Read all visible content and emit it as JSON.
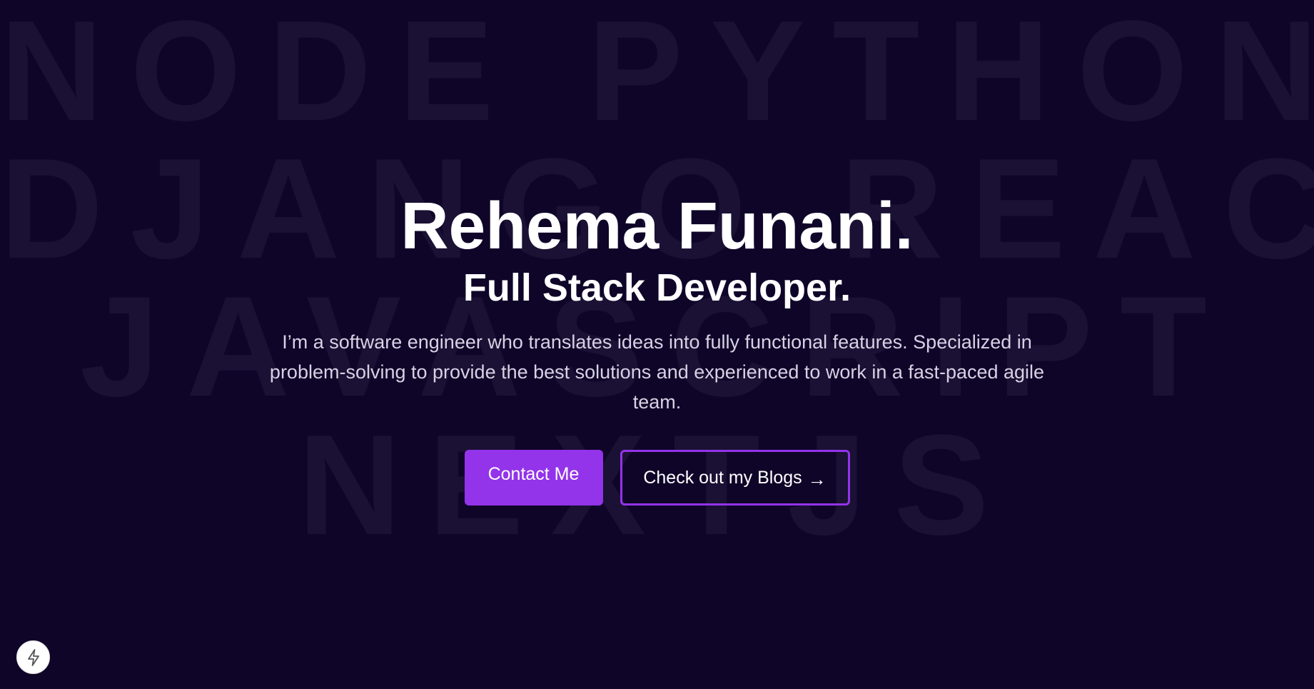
{
  "background_words": [
    "NODE PYTHON",
    "DJANGO REACT",
    "JAVASCRIPT",
    "NEXTJS"
  ],
  "hero": {
    "name": "Rehema Funani.",
    "role": "Full Stack Developer.",
    "bio": "I’m a software engineer who translates ideas into fully functional features. Specialized in problem-solving to provide the best solutions and experienced to work in a fast-paced agile team."
  },
  "actions": {
    "contact_label": "Contact Me",
    "blogs_label": "Check out my Blogs",
    "blogs_arrow": "→"
  },
  "floating_button": {
    "icon": "lightning-bolt-icon"
  },
  "colors": {
    "background": "#0f0529",
    "accent": "#9333ea",
    "background_text": "#1a1134"
  }
}
